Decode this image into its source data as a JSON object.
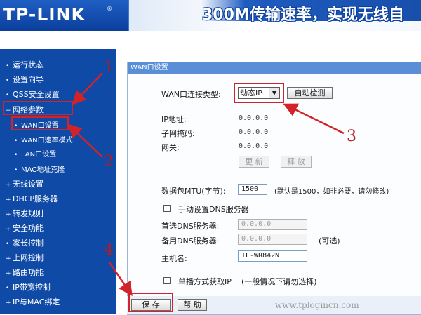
{
  "header": {
    "logo": "TP-LINK",
    "logo_reg": "®",
    "slogan": "300M传输速率，实现无线自"
  },
  "sidebar": {
    "items": [
      {
        "label": "运行状态",
        "bullet": "•"
      },
      {
        "label": "设置向导",
        "bullet": "•"
      },
      {
        "label": "QSS安全设置",
        "bullet": "•"
      },
      {
        "label": "网络参数",
        "bullet": "−"
      },
      {
        "label": "WAN口设置",
        "bullet": "•"
      },
      {
        "label": "WAN口速率模式",
        "bullet": "•"
      },
      {
        "label": "LAN口设置",
        "bullet": "•"
      },
      {
        "label": "MAC地址克隆",
        "bullet": "•"
      },
      {
        "label": "无线设置",
        "bullet": "+"
      },
      {
        "label": "DHCP服务器",
        "bullet": "+"
      },
      {
        "label": "转发规则",
        "bullet": "+"
      },
      {
        "label": "安全功能",
        "bullet": "+"
      },
      {
        "label": "家长控制",
        "bullet": "•"
      },
      {
        "label": "上网控制",
        "bullet": "+"
      },
      {
        "label": "路由功能",
        "bullet": "+"
      },
      {
        "label": "IP带宽控制",
        "bullet": "•"
      },
      {
        "label": "IP与MAC绑定",
        "bullet": "+"
      }
    ]
  },
  "panel": {
    "title": "WAN口设置",
    "conn_type_label": "WAN口连接类型:",
    "conn_type_value": "动态IP",
    "auto_detect_button": "自动检测",
    "ip_label": "IP地址:",
    "ip_value": "0.0.0.0",
    "mask_label": "子网掩码:",
    "mask_value": "0.0.0.0",
    "gateway_label": "网关:",
    "gateway_value": "0.0.0.0",
    "renew_button": "更 新",
    "release_button": "释 放",
    "mtu_label": "数据包MTU(字节):",
    "mtu_value": "1500",
    "mtu_hint": "(默认是1500，如非必要，请勿修改)",
    "manual_dns_label": "手动设置DNS服务器",
    "primary_dns_label": "首选DNS服务器:",
    "primary_dns_value": "0.0.0.0",
    "secondary_dns_label": "备用DNS服务器:",
    "secondary_dns_value": "0.0.0.0",
    "secondary_dns_hint": "(可选)",
    "hostname_label": "主机名:",
    "hostname_value": "TL-WR842N",
    "unicast_label": "单播方式获取IP",
    "unicast_hint": "(一般情况下请勿选择)",
    "save_button": "保 存",
    "help_button": "帮 助"
  },
  "annotations": {
    "callout_1": "1",
    "callout_2": "2",
    "callout_3": "3",
    "callout_4": "4",
    "color": "#d3232a"
  },
  "watermark": "www.tplogincn.com",
  "colors": {
    "sidebar_bg": "#0e4aa6",
    "panel_title_bg": "#5a8fd8",
    "accent": "#1f5fc4"
  }
}
